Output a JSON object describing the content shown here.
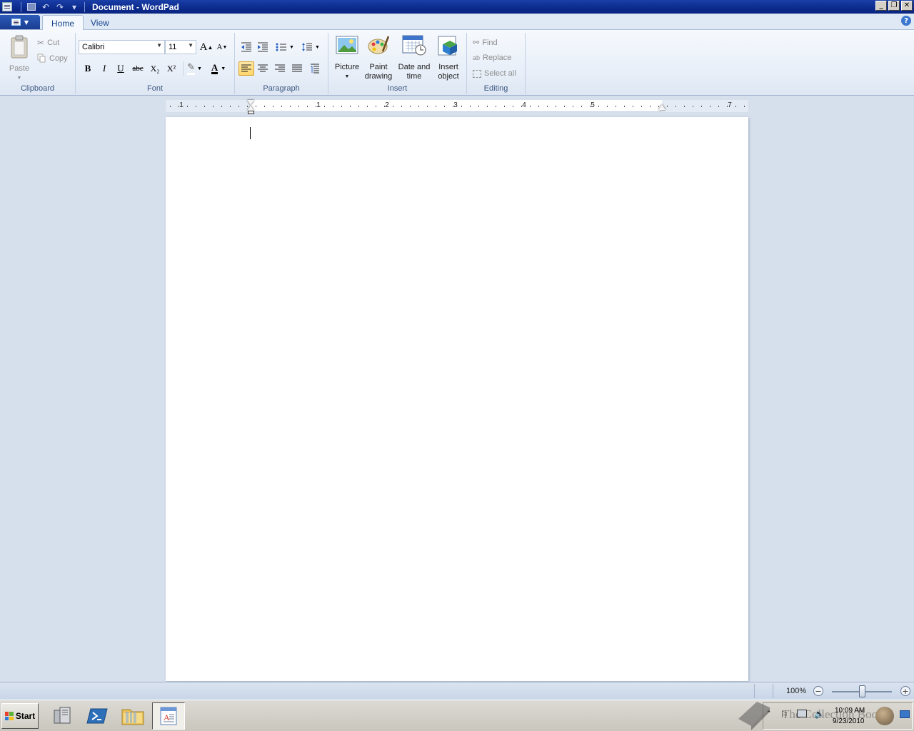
{
  "window": {
    "title": "Document - WordPad",
    "controls": {
      "minimize": "_",
      "maximize": "❐",
      "close": "✕"
    }
  },
  "quick_access": {
    "undo_icon": "undo-icon",
    "redo_icon": "redo-icon",
    "save_icon": "save-icon",
    "undo": "↶",
    "redo": "↷",
    "customize": "▾"
  },
  "tabs": [
    {
      "label": "Home",
      "active": true
    },
    {
      "label": "View",
      "active": false
    }
  ],
  "ribbon": {
    "clipboard": {
      "label": "Clipboard",
      "paste": "Paste",
      "cut": "Cut",
      "copy": "Copy"
    },
    "font": {
      "label": "Font",
      "family": "Calibri",
      "size": "11",
      "grow": "A",
      "shrink": "A",
      "bold": "B",
      "italic": "I",
      "underline": "U",
      "strikethrough": "abc",
      "subscript": "X₂",
      "superscript": "X²",
      "highlight": "✎",
      "font_color": "A"
    },
    "paragraph": {
      "label": "Paragraph"
    },
    "insert": {
      "label": "Insert",
      "picture": "Picture",
      "paint_line1": "Paint",
      "paint_line2": "drawing",
      "date_line1": "Date and",
      "date_line2": "time",
      "object_line1": "Insert",
      "object_line2": "object"
    },
    "editing": {
      "label": "Editing",
      "find": "Find",
      "replace": "Replace",
      "select_all": "Select all"
    }
  },
  "ruler": {
    "numbers": [
      "1",
      "1",
      "2",
      "3",
      "4",
      "5",
      "7"
    ]
  },
  "status": {
    "zoom": "100%",
    "zoom_level": 0.5,
    "zoom_minus": "−",
    "zoom_plus": "+"
  },
  "taskbar": {
    "start": "Start",
    "clock_time": "10:09 AM",
    "clock_date": "9/23/2010",
    "watermark": "The Collection Book"
  },
  "colors": {
    "title_bar": "#0b2a8c",
    "ribbon": "#e7eef8",
    "workspace": "#d6dfec",
    "selected_button": "#ffd66b"
  }
}
